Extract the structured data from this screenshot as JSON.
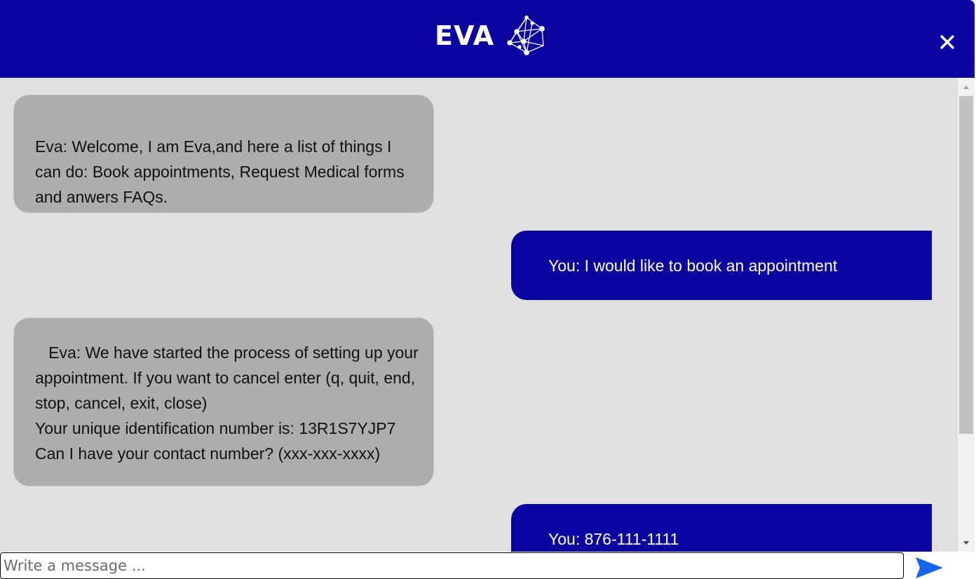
{
  "header": {
    "title": "EVA",
    "logo_icon": "network-nodes-icon",
    "close_icon": "close-icon",
    "color": "#0b039f"
  },
  "messages": [
    {
      "sender": "bot",
      "text": "Eva: Welcome, I am Eva,and here a list of things I can do: Book appointments, Request Medical forms and anwers FAQs."
    },
    {
      "sender": "user",
      "text": "You: I would like to book an appointment"
    },
    {
      "sender": "bot",
      "text": "   Eva: We have started the process of setting up your appointment. If you want to cancel enter (q, quit, end, stop, cancel, exit, close)\nYour unique identification number is: 13R1S7YJP7\nCan I have your contact number? (xxx-xxx-xxxx)"
    },
    {
      "sender": "user",
      "text": "You: 876-111-1111"
    }
  ],
  "composer": {
    "placeholder": "Write a message ...",
    "value": "",
    "send_icon": "send-icon",
    "send_color": "#1565e8"
  },
  "colors": {
    "chat_background": "#e0e0e0",
    "bot_bubble": "#adadad",
    "user_bubble": "#0b039f"
  }
}
